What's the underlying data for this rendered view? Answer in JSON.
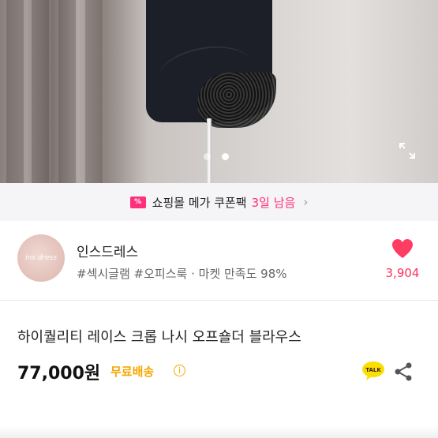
{
  "hero": {
    "slide_count": 2,
    "active_slide": 2,
    "expand_icon": "expand-icon"
  },
  "coupon": {
    "icon": "coupon-ticket-icon",
    "icon_glyph": "%",
    "label": "쇼핑몰 메가 쿠폰팩",
    "days_left": "3일 남음",
    "chevron": "›",
    "accent_color": "#ff2f7a"
  },
  "seller": {
    "name": "인스드레스",
    "tags": "#섹시글램 #오피스룩 · 마켓 만족도 98%",
    "avatar_icon": "seller-avatar",
    "avatar_text": "ins dress",
    "like_count": "3,904",
    "heart_color": "#ff3d63"
  },
  "product": {
    "title": "하이퀄리티 레이스 크롭 나시 오프숄더 블라우스",
    "price": "77,000원",
    "shipping": "무료배송",
    "info_glyph": "i",
    "talk_label": "TALK",
    "shipping_color": "#f5a800"
  }
}
